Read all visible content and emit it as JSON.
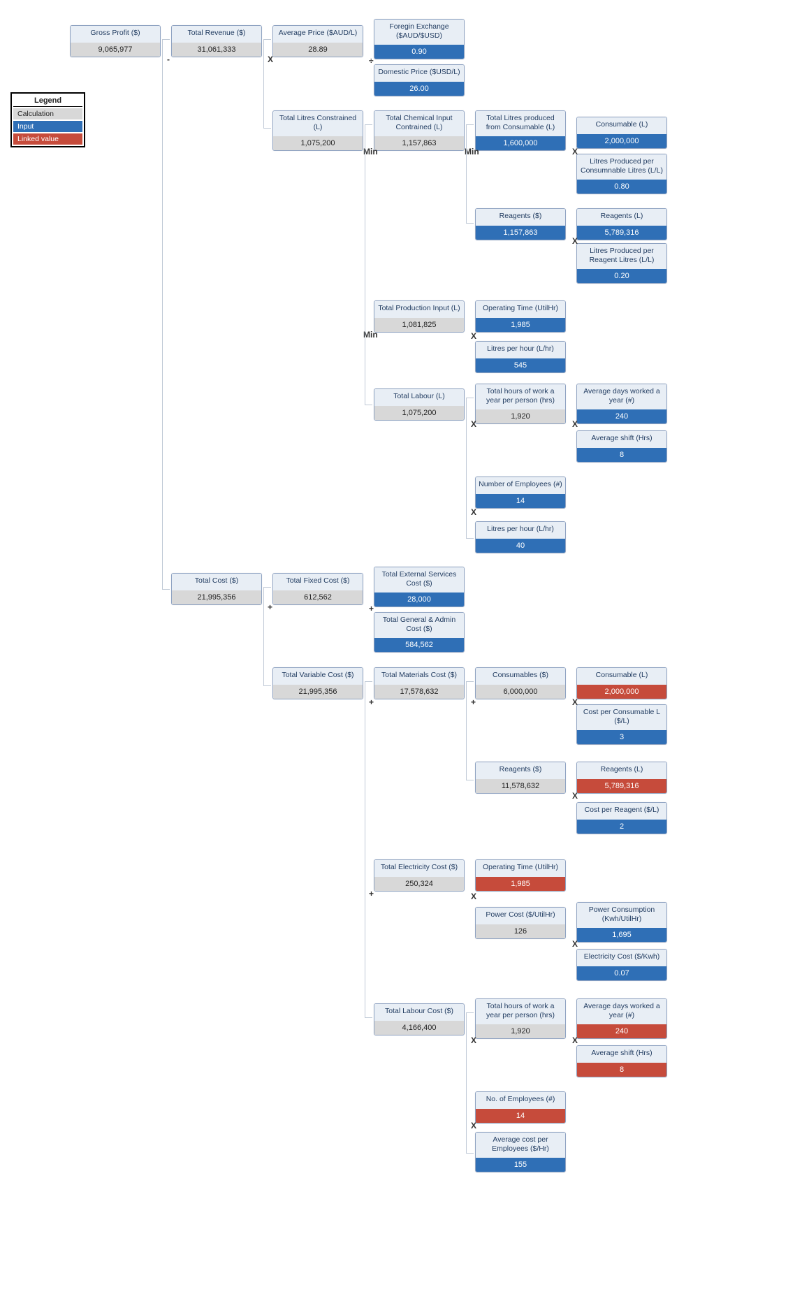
{
  "legend": {
    "title": "Legend",
    "rows": [
      "Calculation",
      "Input",
      "Linked value"
    ]
  },
  "nodes": {
    "grossProfit": {
      "label": "Gross Profit ($)",
      "value": "9,065,977"
    },
    "totalRevenue": {
      "label": "Total Revenue ($)",
      "value": "31,061,333"
    },
    "avgPrice": {
      "label": "Average Price ($AUD/L)",
      "value": "28.89"
    },
    "fx": {
      "label": "Foregin Exchange ($AUD/$USD)",
      "value": "0.90"
    },
    "domPrice": {
      "label": "Domestic Price ($USD/L)",
      "value": "26.00"
    },
    "litresConstr": {
      "label": "Total Litres Constrained (L)",
      "value": "1,075,200"
    },
    "chemConstr": {
      "label": "Total  Chemical Input Contrained (L)",
      "value": "1,157,863"
    },
    "litresFromCons": {
      "label": "Total Litres produced from Consumable (L)",
      "value": "1,600,000"
    },
    "consumableL": {
      "label": "Consumable (L)",
      "value": "2,000,000"
    },
    "lprodPerCons": {
      "label": "Litres Produced per Consumnable Litres (L/L)",
      "value": "0.80"
    },
    "reagentsDollar": {
      "label": "Reagents ($)",
      "value": "1,157,863"
    },
    "reagentsL": {
      "label": "Reagents (L)",
      "value": "5,789,316"
    },
    "lprodPerReag": {
      "label": "Litres Produced per Reagent Litres (L/L)",
      "value": "0.20"
    },
    "totalProdInput": {
      "label": "Total Production Input (L)",
      "value": "1,081,825"
    },
    "opTime": {
      "label": "Operating Time (UtilHr)",
      "value": "1,985"
    },
    "lph": {
      "label": "Litres per hour (L/hr)",
      "value": "545"
    },
    "totalLabour": {
      "label": "Total Labour (L)",
      "value": "1,075,200"
    },
    "hrsPerPerson": {
      "label": "Total hours of work a year per person (hrs)",
      "value": "1,920"
    },
    "daysYear": {
      "label": "Average days worked a year (#)",
      "value": "240"
    },
    "avgShift": {
      "label": "Average shift (Hrs)",
      "value": "8"
    },
    "numEmp": {
      "label": "Number of Employees (#)",
      "value": "14"
    },
    "lph40": {
      "label": "Litres per hour (L/hr)",
      "value": "40"
    },
    "totalCost": {
      "label": "Total Cost ($)",
      "value": "21,995,356"
    },
    "totalFixed": {
      "label": "Total  Fixed Cost ($)",
      "value": "612,562"
    },
    "extSvc": {
      "label": "Total  External Services Cost ($)",
      "value": "28,000"
    },
    "ga": {
      "label": "Total General & Admin Cost ($)",
      "value": "584,562"
    },
    "totalVar": {
      "label": "Total  Variable Cost ($)",
      "value": "21,995,356"
    },
    "matCost": {
      "label": "Total  Materials Cost ($)",
      "value": "17,578,632"
    },
    "consDollar": {
      "label": "Consumables ($)",
      "value": "6,000,000"
    },
    "consL2": {
      "label": "Consumable (L)",
      "value": "2,000,000"
    },
    "costPerCons": {
      "label": "Cost per Consumable L ($/L)",
      "value": "3"
    },
    "reagDollar2": {
      "label": "Reagents ($)",
      "value": "11,578,632"
    },
    "reagL2": {
      "label": "Reagents (L)",
      "value": "5,789,316"
    },
    "costPerReag": {
      "label": "Cost per Reagent ($/L)",
      "value": "2"
    },
    "elecCost": {
      "label": "Total  Electricity Cost ($)",
      "value": "250,324"
    },
    "opTime2": {
      "label": "Operating Time (UtilHr)",
      "value": "1,985"
    },
    "powerCost": {
      "label": "Power Cost ($/UtilHr)",
      "value": "126"
    },
    "powerCons": {
      "label": "Power Consumption (Kwh/UtilHr)",
      "value": "1,695"
    },
    "elecKwh": {
      "label": "Electricity Cost ($/Kwh)",
      "value": "0.07"
    },
    "labourCost": {
      "label": "Total  Labour Cost ($)",
      "value": "4,166,400"
    },
    "hrsPerPerson2": {
      "label": "Total hours of work a year per person (hrs)",
      "value": "1,920"
    },
    "daysYear2": {
      "label": "Average days worked a year (#)",
      "value": "240"
    },
    "avgShift2": {
      "label": "Average shift (Hrs)",
      "value": "8"
    },
    "noEmp2": {
      "label": "No. of  Employees (#)",
      "value": "14"
    },
    "avgCostEmp": {
      "label": "Average cost per Employees ($/Hr)",
      "value": "155"
    }
  },
  "ops": {
    "minus": "-",
    "plus": "+",
    "mult": "X",
    "div": "÷",
    "min": "Min"
  }
}
